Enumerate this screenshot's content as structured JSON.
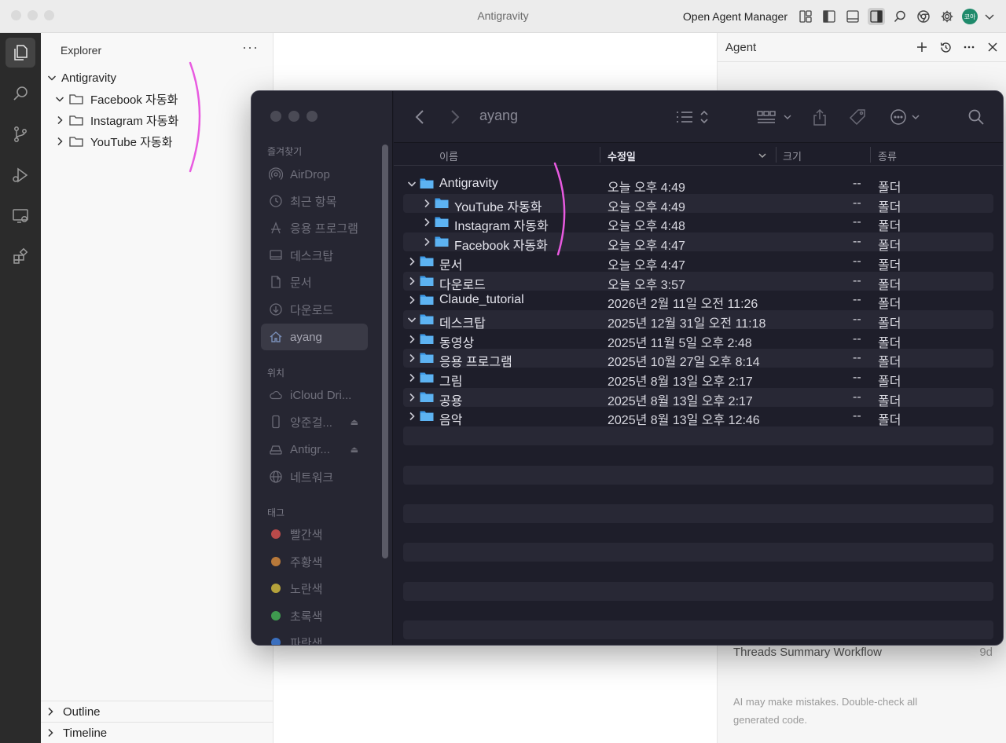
{
  "window": {
    "title": "Antigravity",
    "agent_manager_label": "Open Agent Manager",
    "avatar_text": "코아"
  },
  "explorer": {
    "title": "Explorer",
    "more": "···",
    "root": "Antigravity",
    "children": [
      {
        "label": "Facebook 자동화",
        "expanded": true
      },
      {
        "label": "Instagram 자동화",
        "expanded": false
      },
      {
        "label": "YouTube 자동화",
        "expanded": false
      }
    ],
    "outline_label": "Outline",
    "timeline_label": "Timeline"
  },
  "agent": {
    "title": "Agent",
    "conversation": {
      "title": "Threads Summary Workflow",
      "age": "9d"
    },
    "disclaimer": "AI may make mistakes. Double-check all generated code."
  },
  "finder": {
    "title": "ayang",
    "sidebar": {
      "favorites_label": "즐겨찾기",
      "favorites": [
        {
          "label": "AirDrop",
          "icon": "airdrop-icon"
        },
        {
          "label": "최근 항목",
          "icon": "clock-icon"
        },
        {
          "label": "응용 프로그램",
          "icon": "applications-icon"
        },
        {
          "label": "데스크탑",
          "icon": "desktop-icon"
        },
        {
          "label": "문서",
          "icon": "document-icon"
        },
        {
          "label": "다운로드",
          "icon": "download-icon"
        },
        {
          "label": "ayang",
          "icon": "home-icon",
          "active": true
        }
      ],
      "locations_label": "위치",
      "locations": [
        {
          "label": "iCloud Dri...",
          "icon": "cloud-icon"
        },
        {
          "label": "양준걸...",
          "icon": "phone-icon",
          "eject": true
        },
        {
          "label": "Antigr...",
          "icon": "drive-icon",
          "eject": true
        },
        {
          "label": "네트워크",
          "icon": "globe-icon"
        }
      ],
      "tags_label": "태그",
      "tags": [
        {
          "label": "빨간색",
          "color": "#b94a4a"
        },
        {
          "label": "주황색",
          "color": "#b8793a"
        },
        {
          "label": "노란색",
          "color": "#b5a23b"
        },
        {
          "label": "초록색",
          "color": "#3f9a4f"
        },
        {
          "label": "파란색",
          "color": "#3a6fbf"
        }
      ]
    },
    "columns": {
      "name": "이름",
      "modified": "수정일",
      "size": "크기",
      "kind": "종류"
    },
    "rows": [
      {
        "name": "Antigravity",
        "date": "오늘 오후 4:49",
        "size": "--",
        "kind": "폴더",
        "level": 0,
        "expanded": true
      },
      {
        "name": "YouTube 자동화",
        "date": "오늘 오후 4:49",
        "size": "--",
        "kind": "폴더",
        "level": 1,
        "expanded": false
      },
      {
        "name": "Instagram 자동화",
        "date": "오늘 오후 4:48",
        "size": "--",
        "kind": "폴더",
        "level": 1,
        "expanded": false
      },
      {
        "name": "Facebook 자동화",
        "date": "오늘 오후 4:47",
        "size": "--",
        "kind": "폴더",
        "level": 1,
        "expanded": false
      },
      {
        "name": "문서",
        "date": "오늘 오후 4:47",
        "size": "--",
        "kind": "폴더",
        "level": 0,
        "expanded": false
      },
      {
        "name": "다운로드",
        "date": "오늘 오후 3:57",
        "size": "--",
        "kind": "폴더",
        "level": 0,
        "expanded": false
      },
      {
        "name": "Claude_tutorial",
        "date": "2026년 2월 11일 오전 11:26",
        "size": "--",
        "kind": "폴더",
        "level": 0,
        "expanded": false
      },
      {
        "name": "데스크탑",
        "date": "2025년 12월 31일 오전 11:18",
        "size": "--",
        "kind": "폴더",
        "level": 0,
        "expanded": true
      },
      {
        "name": "동영상",
        "date": "2025년 11월 5일 오후 2:48",
        "size": "--",
        "kind": "폴더",
        "level": 0,
        "expanded": false
      },
      {
        "name": "응용 프로그램",
        "date": "2025년 10월 27일 오후 8:14",
        "size": "--",
        "kind": "폴더",
        "level": 0,
        "expanded": false
      },
      {
        "name": "그림",
        "date": "2025년 8월 13일 오후 2:17",
        "size": "--",
        "kind": "폴더",
        "level": 0,
        "expanded": false
      },
      {
        "name": "공용",
        "date": "2025년 8월 13일 오후 2:17",
        "size": "--",
        "kind": "폴더",
        "level": 0,
        "expanded": false
      },
      {
        "name": "음악",
        "date": "2025년 8월 13일 오후 12:46",
        "size": "--",
        "kind": "폴더",
        "level": 0,
        "expanded": false
      }
    ]
  },
  "colors": {
    "accent_folder": "#3d9be9",
    "annotation": "#e85ae0"
  }
}
